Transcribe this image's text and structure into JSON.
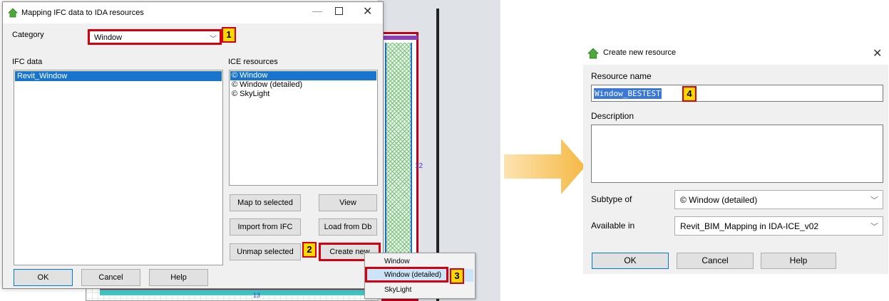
{
  "main_dialog": {
    "title": "Mapping IFC data to IDA resources",
    "minimize": "—",
    "close": "✕",
    "category_label": "Category",
    "category_value": "Window",
    "ifc_label": "IFC data",
    "ifc_items": [
      "Revit_Window"
    ],
    "ice_label": "ICE resources",
    "ice_items": [
      "© Window",
      "© Window (detailed)",
      "© SkyLight"
    ],
    "buttons": {
      "map": "Map to selected",
      "view": "View",
      "import": "Import from IFC",
      "load": "Load from Db",
      "unmap": "Unmap selected",
      "create": "Create new",
      "ok": "OK",
      "cancel": "Cancel",
      "help": "Help"
    }
  },
  "dropdown_menu": {
    "items": [
      "Window",
      "Window (detailed)",
      "SkyLight"
    ],
    "selected": "Window (detailed)"
  },
  "badges": [
    "1",
    "2",
    "3",
    "4"
  ],
  "plan_labels": [
    "12",
    "13"
  ],
  "create_dialog": {
    "title": "Create new resource",
    "close": "✕",
    "resource_name_label": "Resource name",
    "resource_name_value": "Window_BESTEST",
    "description_label": "Description",
    "subtype_label": "Subtype of",
    "subtype_value": "© Window (detailed)",
    "available_label": "Available in",
    "available_value": "Revit_BIM_Mapping in IDA-ICE_v02",
    "ok": "OK",
    "cancel": "Cancel",
    "help": "Help"
  },
  "colors": {
    "highlight_red": "#d4000f",
    "badge_yellow": "#ffd800",
    "selection_blue": "#1874cd",
    "arrow": "#f7c35c"
  }
}
